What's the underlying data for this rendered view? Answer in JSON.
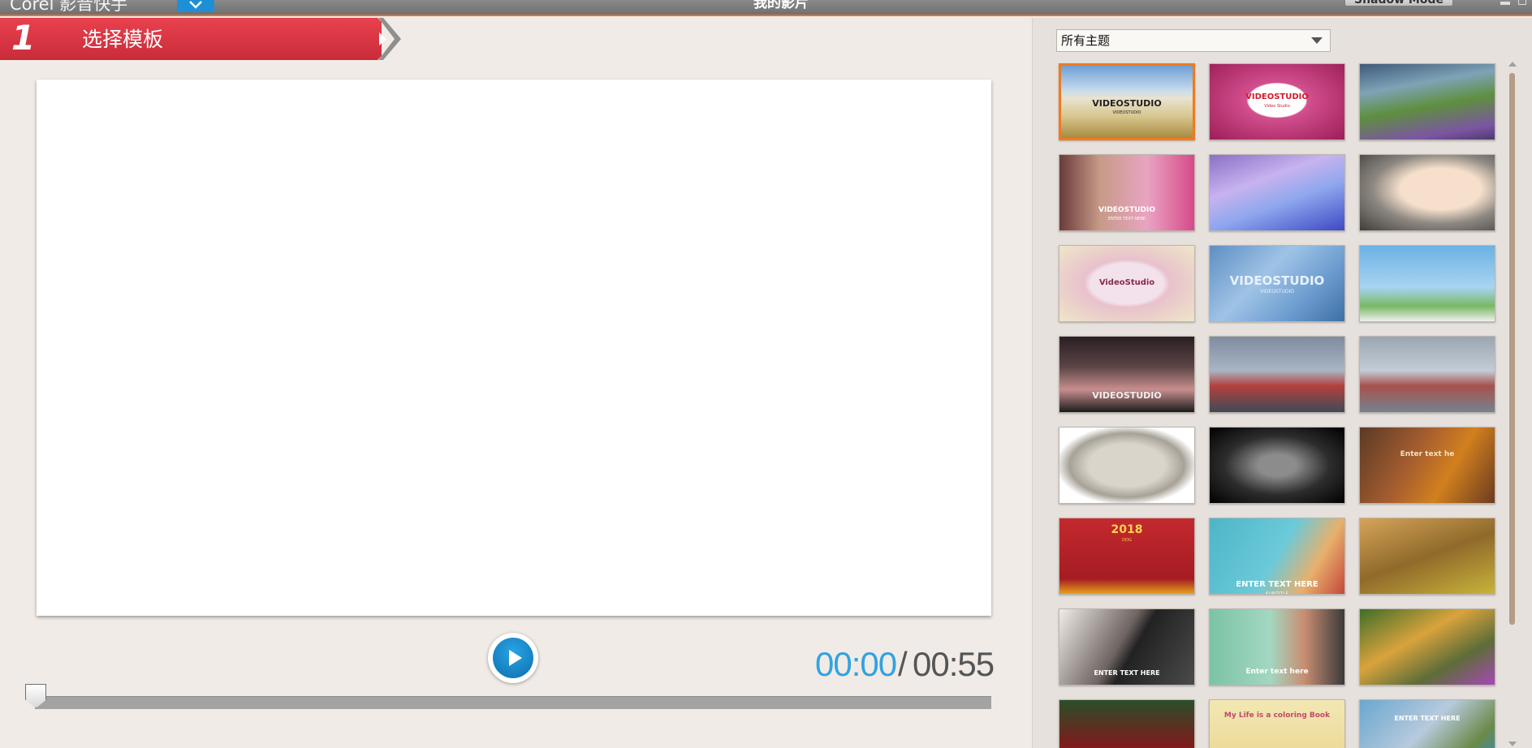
{
  "titlebar": {
    "app_title": "Corel 影音快手",
    "project_title": "我的影片",
    "mode_button": "Shadow Mode",
    "menu_icon": "chevron-down-icon"
  },
  "step": {
    "number": "1",
    "label": "选择模板"
  },
  "playback": {
    "current_time": "00:00",
    "separator": "/",
    "total_time": "00:55",
    "progress": 0
  },
  "theme_filter": {
    "selected": "所有主题"
  },
  "templates": [
    {
      "caption": "VIDEOSTUDIO",
      "sub": "VIDEOSTUDIO",
      "selected": true
    },
    {
      "caption": "VIDEOSTUDIO",
      "sub": "Video Studio"
    },
    {
      "caption": ""
    },
    {
      "caption": "VIDEOSTUDIO",
      "sub": "ENTER TEXT HERE"
    },
    {
      "caption": ""
    },
    {
      "caption": ""
    },
    {
      "caption": "VideoStudio"
    },
    {
      "caption": "VIDEOSTUDIO",
      "sub": "VIDEOSTUDIO"
    },
    {
      "caption": ""
    },
    {
      "caption": "VIDEOSTUDIO"
    },
    {
      "caption": ""
    },
    {
      "caption": ""
    },
    {
      "caption": ""
    },
    {
      "caption": ""
    },
    {
      "caption": "Enter text he"
    },
    {
      "caption": "2018",
      "sub": "DOG"
    },
    {
      "caption": "ENTER TEXT HERE",
      "sub": "SUBTITLE"
    },
    {
      "caption": ""
    },
    {
      "caption": "ENTER TEXT HERE"
    },
    {
      "caption": "Enter text here"
    },
    {
      "caption": ""
    },
    {
      "caption": ""
    },
    {
      "caption": "My Life is a coloring Book"
    },
    {
      "caption": "ENTER TEXT HERE"
    }
  ]
}
